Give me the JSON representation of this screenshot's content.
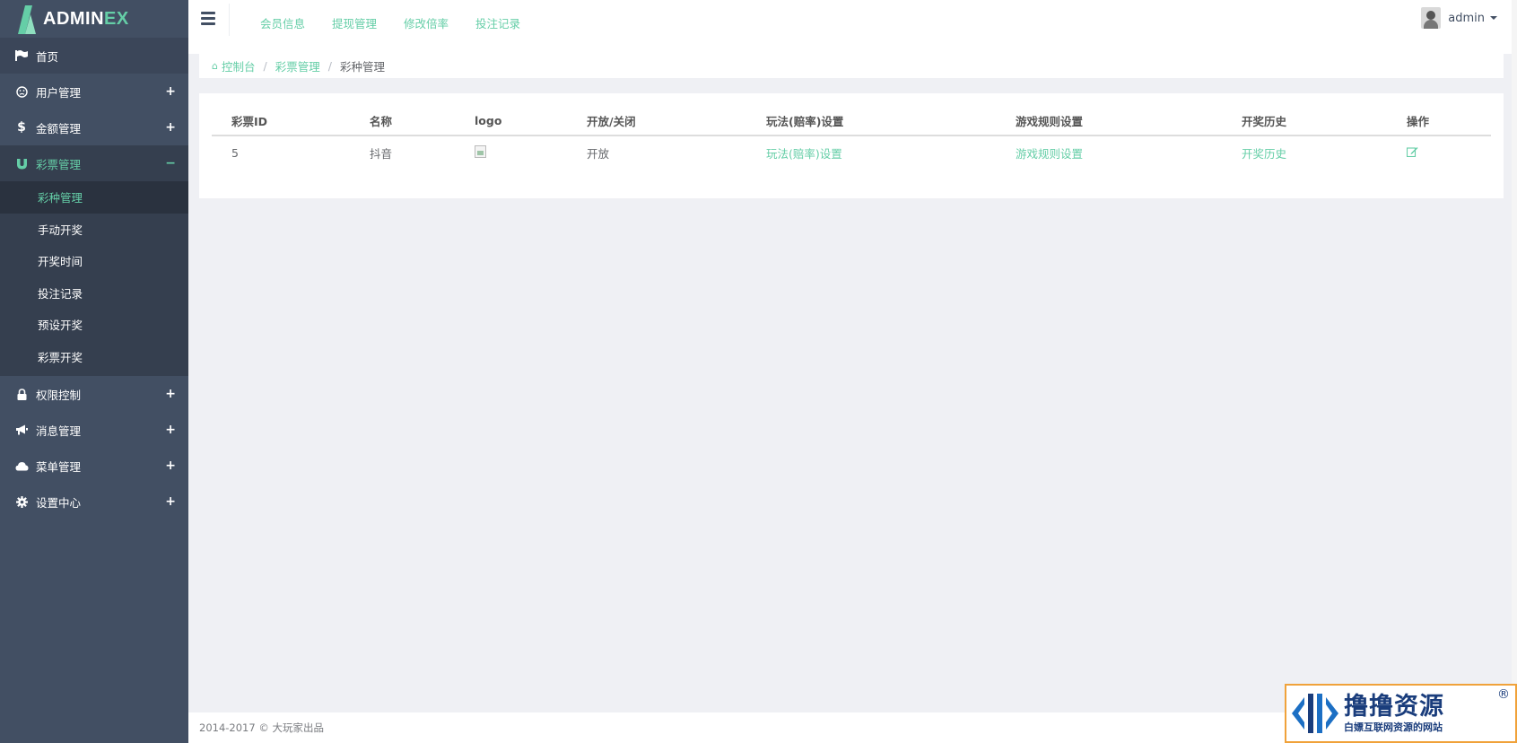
{
  "app": {
    "logo_main": "ADMIN",
    "logo_accent": "EX"
  },
  "sidebar": {
    "items": [
      {
        "label": "首页",
        "icon": "flag-icon"
      },
      {
        "label": "用户管理",
        "icon": "user-circle-icon",
        "toggle": "+"
      },
      {
        "label": "金额管理",
        "icon": "dollar-icon",
        "toggle": "+"
      },
      {
        "label": "彩票管理",
        "icon": "magnet-icon",
        "toggle": "−"
      },
      {
        "label": "权限控制",
        "icon": "lock-icon",
        "toggle": "+"
      },
      {
        "label": "消息管理",
        "icon": "bullhorn-icon",
        "toggle": "+"
      },
      {
        "label": "菜单管理",
        "icon": "cloud-icon",
        "toggle": "+"
      },
      {
        "label": "设置中心",
        "icon": "gear-icon",
        "toggle": "+"
      }
    ],
    "submenu": [
      "彩种管理",
      "手动开奖",
      "开奖时间",
      "投注记录",
      "预设开奖",
      "彩票开奖"
    ]
  },
  "header": {
    "links": [
      "会员信息",
      "提现管理",
      "修改倍率",
      "投注记录"
    ],
    "user_name": "admin"
  },
  "breadcrumb": {
    "home": "控制台",
    "parent": "彩票管理",
    "current": "彩种管理"
  },
  "table": {
    "headers": [
      "彩票ID",
      "名称",
      "logo",
      "开放/关闭",
      "玩法(赔率)设置",
      "游戏规则设置",
      "开奖历史",
      "操作"
    ],
    "rows": [
      {
        "id": "5",
        "name": "抖音",
        "status": "开放",
        "play": "玩法(赔率)设置",
        "rules": "游戏规则设置",
        "history": "开奖历史"
      }
    ]
  },
  "footer": {
    "text": "2014-2017 © 大玩家出品"
  },
  "watermark": {
    "title": "撸撸资源",
    "subtitle": "白嫖互联网资源的网站",
    "reg": "®"
  },
  "colors": {
    "accent": "#65cea7",
    "sidebar": "#424f63",
    "background": "#eff0f4"
  }
}
